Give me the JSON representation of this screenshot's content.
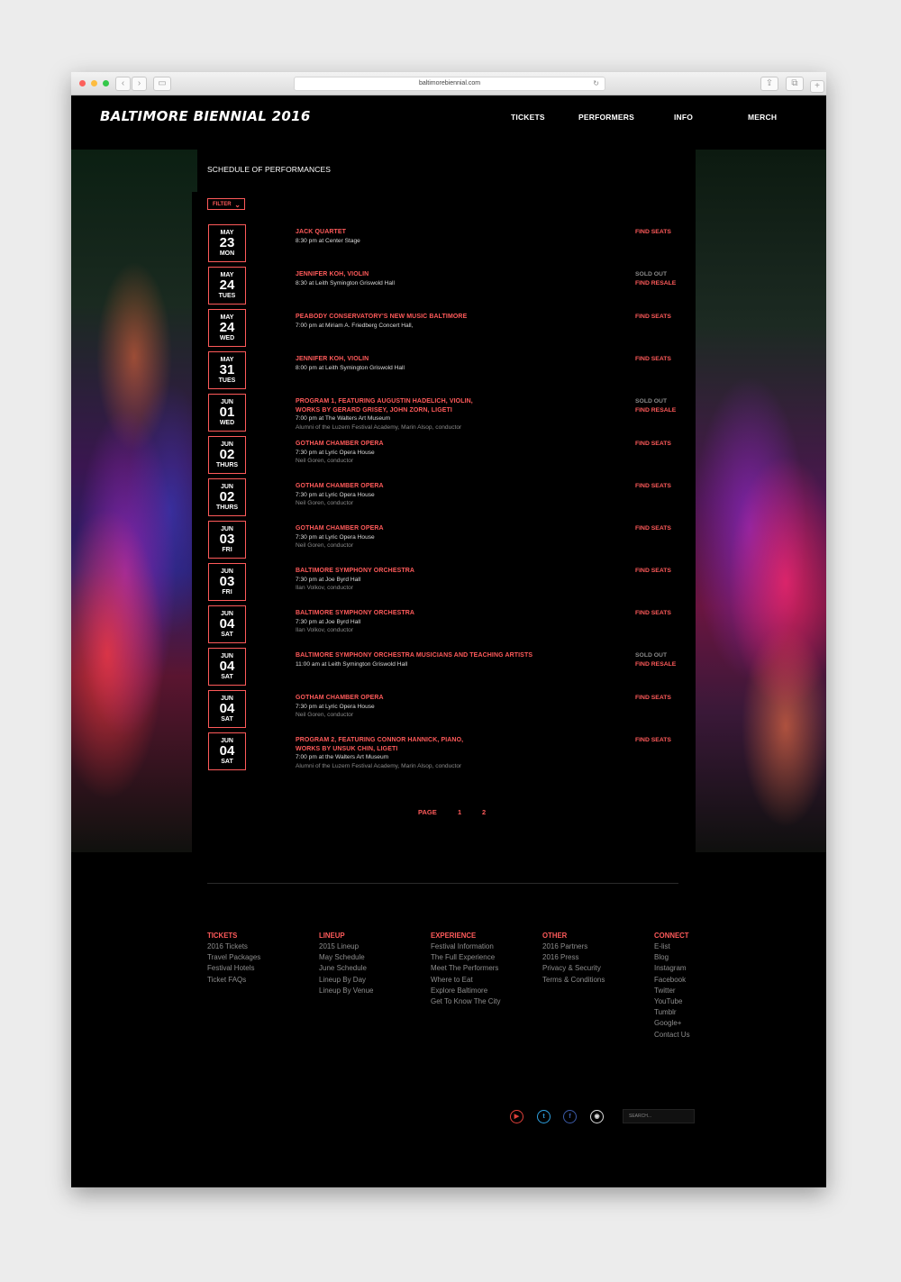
{
  "browser": {
    "url": "baltimorebiennial.com",
    "back_icon": "chevron-left-icon",
    "forward_icon": "chevron-right-icon"
  },
  "header": {
    "logo": "BALTIMORE BIENNIAL 2016",
    "nav": [
      "TICKETS",
      "PERFORMERS",
      "INFO",
      "MERCH"
    ]
  },
  "page_title": "SCHEDULE OF PERFORMANCES",
  "filter_label": "FILTER",
  "events": [
    {
      "month": "MAY",
      "day": "23",
      "weekday": "MON",
      "title": "JACK QUARTET",
      "title2": "",
      "details": "8:30 pm at Center Stage",
      "note": "",
      "sold_out": "",
      "action": "FIND SEATS"
    },
    {
      "month": "MAY",
      "day": "24",
      "weekday": "TUES",
      "title": "JENNIFER KOH, VIOLIN",
      "title2": "",
      "details": "8:30 at Leith Symington Griswold Hall",
      "note": "",
      "sold_out": "SOLD OUT",
      "action": "FIND RESALE"
    },
    {
      "month": "MAY",
      "day": "24",
      "weekday": "WED",
      "title": "PEABODY CONSERVATORY'S NEW MUSIC BALTIMORE",
      "title2": "",
      "details": "7:00 pm at Miriam A. Friedberg Concert Hall,",
      "note": "",
      "sold_out": "",
      "action": "FIND SEATS"
    },
    {
      "month": "MAY",
      "day": "31",
      "weekday": "TUES",
      "title": "JENNIFER KOH, VIOLIN",
      "title2": "",
      "details": "8:00 pm at Leith Symington Griswold Hall",
      "note": "",
      "sold_out": "",
      "action": "FIND SEATS"
    },
    {
      "month": "JUN",
      "day": "01",
      "weekday": "WED",
      "title": "PROGRAM 1, FEATURING AUGUSTIN HADELICH, VIOLIN,",
      "title2": "WORKS BY GERARD GRISEY, JOHN ZORN, LIGETI",
      "details": "7:00 pm at The Walters Art Museum",
      "note": "Alumni of the Luzern Festival Academy, Marin Alsop, conductor",
      "sold_out": "SOLD OUT",
      "action": "FIND RESALE"
    },
    {
      "month": "JUN",
      "day": "02",
      "weekday": "THURS",
      "title": "GOTHAM CHAMBER OPERA",
      "title2": "",
      "details": "7:30 pm at Lyric Opera House",
      "note": "Neil Goren, conductor",
      "sold_out": "",
      "action": "FIND SEATS"
    },
    {
      "month": "JUN",
      "day": "02",
      "weekday": "THURS",
      "title": "GOTHAM CHAMBER OPERA",
      "title2": "",
      "details": "7:30 pm at Lyric Opera House",
      "note": "Neil Goren, conductor",
      "sold_out": "",
      "action": "FIND SEATS"
    },
    {
      "month": "JUN",
      "day": "03",
      "weekday": "FRI",
      "title": "GOTHAM CHAMBER OPERA",
      "title2": "",
      "details": "7:30 pm at Lyric Opera House",
      "note": "Neil Goren, conductor",
      "sold_out": "",
      "action": "FIND SEATS"
    },
    {
      "month": "JUN",
      "day": "03",
      "weekday": "FRI",
      "title": "BALTIMORE SYMPHONY ORCHESTRA",
      "title2": "",
      "details": "7:30 pm at Joe Byrd Hall",
      "note": "Ilan Volkov, conductor",
      "sold_out": "",
      "action": "FIND SEATS"
    },
    {
      "month": "JUN",
      "day": "04",
      "weekday": "SAT",
      "title": "BALTIMORE SYMPHONY ORCHESTRA",
      "title2": "",
      "details": "7:30 pm at Joe Byrd Hall",
      "note": "Ilan Volkov, conductor",
      "sold_out": "",
      "action": "FIND SEATS"
    },
    {
      "month": "JUN",
      "day": "04",
      "weekday": "SAT",
      "title": "BALTIMORE SYMPHONY ORCHESTRA MUSICIANS AND TEACHING ARTISTS",
      "title2": "",
      "details": "11:00 am at Leith Symington Griswold Hall",
      "note": "",
      "sold_out": "SOLD OUT",
      "action": "FIND RESALE"
    },
    {
      "month": "JUN",
      "day": "04",
      "weekday": "SAT",
      "title": "GOTHAM CHAMBER OPERA",
      "title2": "",
      "details": "7:30 pm at Lyric Opera House",
      "note": "Neil Goren, conductor",
      "sold_out": "",
      "action": "FIND SEATS"
    },
    {
      "month": "JUN",
      "day": "04",
      "weekday": "SAT",
      "title": "PROGRAM 2, FEATURING CONNOR HANNICK, PIANO,",
      "title2": "WORKS BY UNSUK CHIN, LIGETI",
      "details": "7:00 pm at the Walters Art Museum",
      "note": "Alumni of the Luzern Festival Academy, Marin Alsop, conductor",
      "sold_out": "",
      "action": "FIND SEATS"
    }
  ],
  "pagination": {
    "label": "PAGE",
    "pages": [
      "1",
      "2"
    ]
  },
  "footer": {
    "columns": [
      {
        "heading": "TICKETS",
        "items": [
          "2016 Tickets",
          "Travel Packages",
          "Festival Hotels",
          "Ticket FAQs"
        ]
      },
      {
        "heading": "LINEUP",
        "items": [
          "2015 Lineup",
          "May Schedule",
          "June Schedule",
          "Lineup By Day",
          "Lineup By Venue"
        ]
      },
      {
        "heading": "EXPERIENCE",
        "items": [
          "Festival Information",
          "The Full Experience",
          "Meet The Performers",
          "Where to Eat",
          "Explore Baltimore",
          "Get To Know The City"
        ]
      },
      {
        "heading": "OTHER",
        "items": [
          "2016 Partners",
          "2016 Press",
          "Privacy & Security",
          "Terms & Conditions"
        ]
      },
      {
        "heading": "CONNECT",
        "items": [
          "E-list",
          "Blog",
          "Instagram",
          "Facebook",
          "Twitter",
          "YouTube",
          "Tumblr",
          "Google+",
          "Contact Us"
        ]
      }
    ],
    "social": [
      {
        "name": "youtube-icon",
        "glyph": "▶",
        "color": "#e0403a"
      },
      {
        "name": "twitter-icon",
        "glyph": "t",
        "color": "#2ea0e0"
      },
      {
        "name": "facebook-icon",
        "glyph": "f",
        "color": "#3b5aa8"
      },
      {
        "name": "instagram-icon",
        "glyph": "◉",
        "color": "#dddddd"
      }
    ],
    "search_placeholder": "SEARCH..."
  }
}
